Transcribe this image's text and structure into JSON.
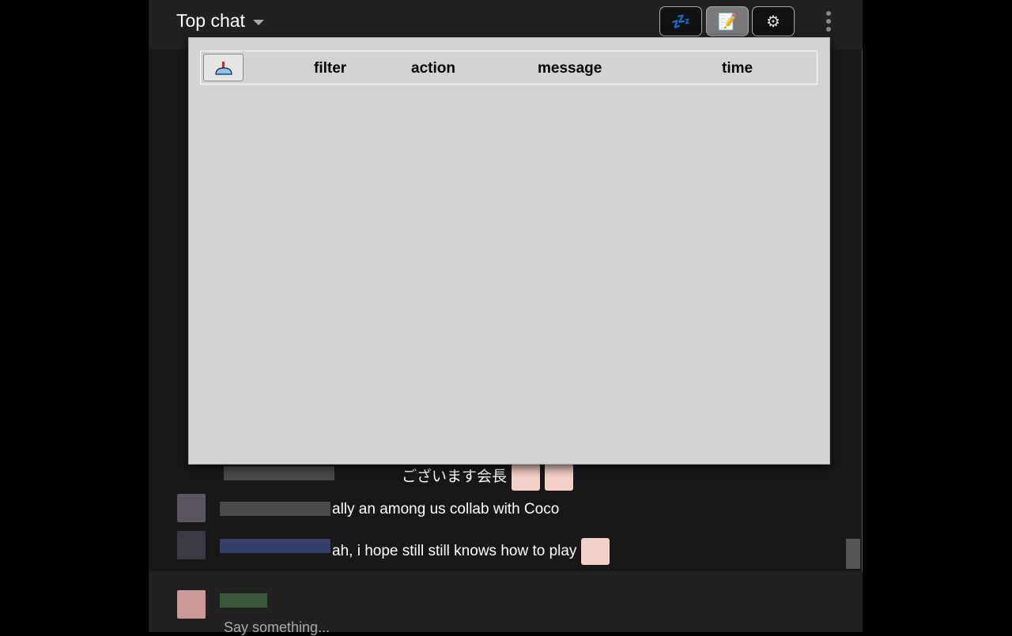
{
  "header": {
    "title": "Top chat",
    "buttons": [
      {
        "name": "sleep-button",
        "icon": "zzz-icon",
        "glyph": "💤"
      },
      {
        "name": "log-button",
        "icon": "memo-icon",
        "glyph": "📝",
        "active": true
      },
      {
        "name": "settings-button",
        "icon": "gear-icon",
        "glyph": "⚙"
      }
    ]
  },
  "panel": {
    "clear_icon": "broom-icon",
    "columns": [
      "filter",
      "action",
      "message",
      "time"
    ]
  },
  "messages": [
    {
      "text": "ございます会長"
    },
    {
      "text": "ally an among us collab with Coco"
    },
    {
      "text": "ah, i hope still still knows how to play"
    }
  ],
  "input": {
    "placeholder": "Say something..."
  }
}
